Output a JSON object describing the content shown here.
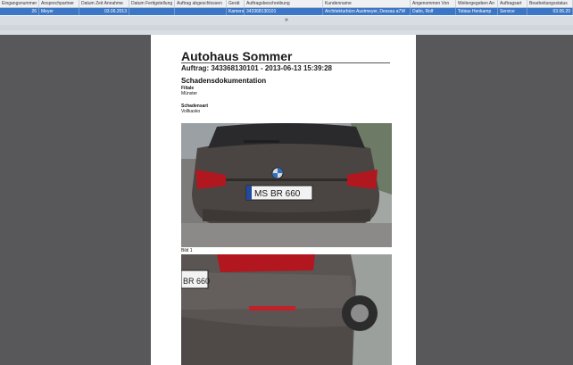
{
  "grid": {
    "columns": [
      "Eingangsnummer",
      "Ansprechpartner",
      "Datum Zeit Annahme",
      "Datum Fertigstellung",
      "Auftrag abgeschlossen",
      "Gerät",
      "Auftragsbeschreibung",
      "Kundenname",
      "Angenommen Von",
      "Weitergegeben An",
      "Auftragsart",
      "Bearbeitungsstatus"
    ],
    "row": [
      "26",
      "Meyer",
      "03.06.2013",
      "",
      "",
      "Kamera",
      "343368130101",
      "Architekturbüro Austmeyer, Dessau a7W",
      "Dalto, Rolf",
      "Tobias Henkamp",
      "Service",
      "03.06.20"
    ]
  },
  "splitter": {
    "grip": "»"
  },
  "document": {
    "title": "Autohaus Sommer",
    "order_line": "Auftrag: 343368130101 - 2013-06-13 15:39:28",
    "section": "Schadensdokumentation",
    "branch_label": "Filiale",
    "branch_value": "Münster",
    "damage_label": "Schadensart",
    "damage_value": "Vollkasko",
    "photo1": {
      "brand": "BMW",
      "plate_prefix": "MS",
      "plate_number": "BR 660",
      "caption": "Bild 1"
    },
    "photo2": {
      "plate_fragment": "BR 660"
    }
  }
}
